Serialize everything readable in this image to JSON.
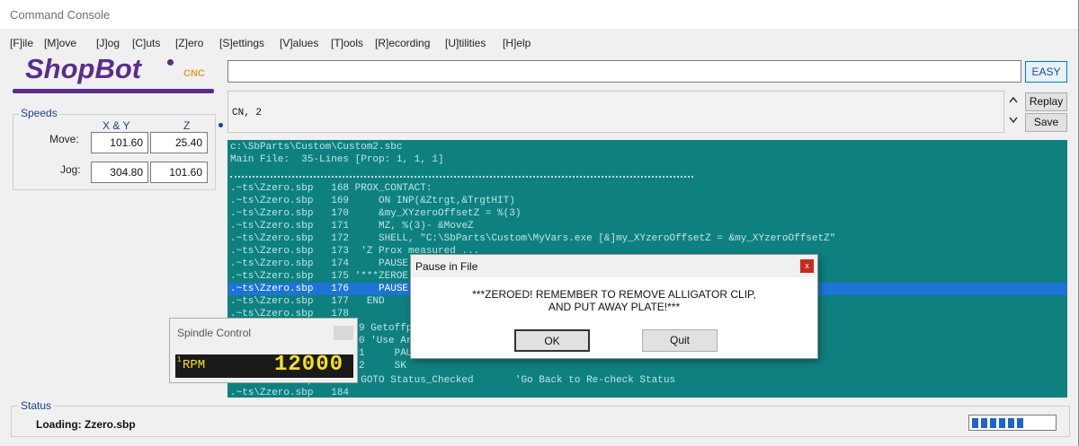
{
  "window": {
    "title": "Command Console"
  },
  "menu": [
    "[F]ile",
    "[M]ove",
    "[J]og",
    "[C]uts",
    "[Z]ero",
    "[S]ettings",
    "[V]alues",
    "[T]ools",
    "[R]ecording",
    "[U]tilities",
    "[H]elp"
  ],
  "logo": {
    "brand": "ShopBot",
    "suffix": "CNC"
  },
  "speeds": {
    "title": "Speeds",
    "col_xy": "X & Y",
    "col_z": "Z",
    "move_label": "Move:",
    "jog_label": "Jog:",
    "move_xy": "101.60",
    "move_z": "25.40",
    "jog_xy": "304.80",
    "jog_z": "101.60"
  },
  "command": {
    "value": "",
    "easy_label": "EASY",
    "history": "CN, 2",
    "replay_label": "Replay",
    "save_label": "Save"
  },
  "console": {
    "lines": [
      "c:\\SbParts\\Custom\\Custom2.sbc",
      "Main File:  35-Lines [Prop: 1, 1, 1]",
      ".~ts\\Zzero.sbp   168 PROX_CONTACT:",
      ".~ts\\Zzero.sbp   169     ON INP(&Ztrgt,&TrgtHIT)",
      ".~ts\\Zzero.sbp   170     &my_XYzeroOffsetZ = %(3)",
      ".~ts\\Zzero.sbp   171     MZ, %(3)- &MoveZ",
      ".~ts\\Zzero.sbp   172     SHELL, \"C:\\SbParts\\Custom\\MyVars.exe [&]my_XYzeroOffsetZ = &my_XYzeroOffsetZ\"",
      ".~ts\\Zzero.sbp   173  'Z Prox measured ...",
      ".~ts\\Zzero.sbp   174     PAUSE",
      ".~ts\\Zzero.sbp   175 '***ZEROE",
      ".~ts\\Zzero.sbp   176     PAUSE",
      ".~ts\\Zzero.sbp   177   END",
      ".~ts\\Zzero.sbp   178",
      "9 Getoffpro",
      "0 'Use Arro",
      "1     PAUSE",
      "2     SK",
      ".~ts\\Zzero.sbp   183  GOTO Status_Checked       'Go Back to Re-check Status",
      ".~ts\\Zzero.sbp   184"
    ],
    "highlight_index": 10
  },
  "dialog": {
    "title": "Pause in File",
    "close": "x",
    "message_line1": "***ZEROED! REMEMBER TO REMOVE ALLIGATOR CLIP,",
    "message_line2": "AND PUT AWAY PLATE!***",
    "ok_label": "OK",
    "quit_label": "Quit"
  },
  "spindle": {
    "title": "Spindle Control",
    "channel": "1",
    "unit": "RPM",
    "value": "12000"
  },
  "status": {
    "title": "Status",
    "text": "Loading: Zzero.sbp",
    "progress_segments": 6,
    "progress_total": 7
  },
  "colors": {
    "console_bg": "#0f8080",
    "highlight": "#1e74d6",
    "logo": "#5b2d8c",
    "lcd_text": "#f5e020"
  }
}
